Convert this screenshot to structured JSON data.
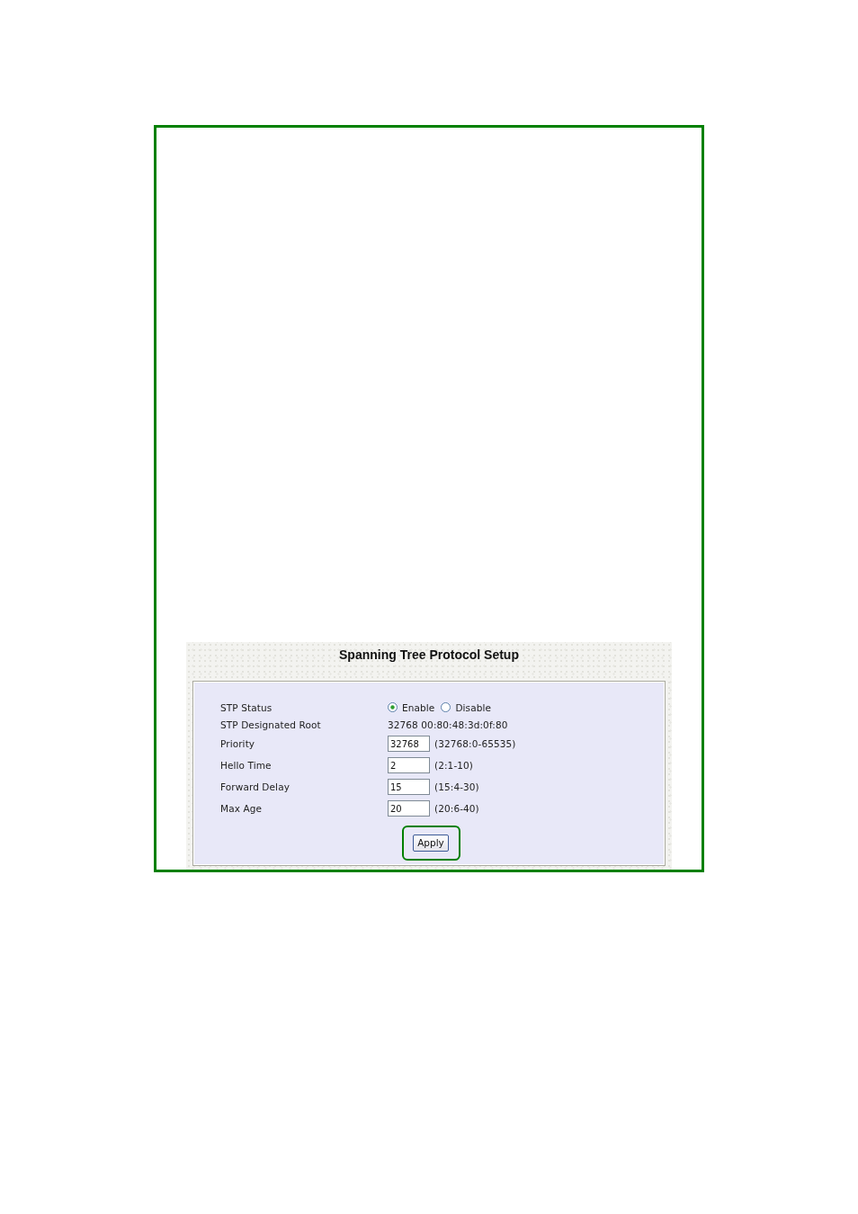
{
  "panel": {
    "title": "Spanning Tree Protocol Setup"
  },
  "fields": [
    {
      "kind": "radio",
      "label": "STP Status",
      "options": [
        {
          "label": "Enable",
          "selected": true
        },
        {
          "label": "Disable",
          "selected": false
        }
      ]
    },
    {
      "kind": "text",
      "label": "STP Designated Root",
      "value": "32768 00:80:48:3d:0f:80"
    },
    {
      "kind": "input",
      "label": "Priority",
      "value": "32768",
      "hint": "(32768:0-65535)"
    },
    {
      "kind": "input",
      "label": "Hello Time",
      "value": "2",
      "hint": "(2:1-10)"
    },
    {
      "kind": "input",
      "label": "Forward Delay",
      "value": "15",
      "hint": "(15:4-30)"
    },
    {
      "kind": "input",
      "label": "Max Age",
      "value": "20",
      "hint": "(20:6-40)"
    }
  ],
  "apply_button": {
    "label": "Apply",
    "highlighted": true
  }
}
